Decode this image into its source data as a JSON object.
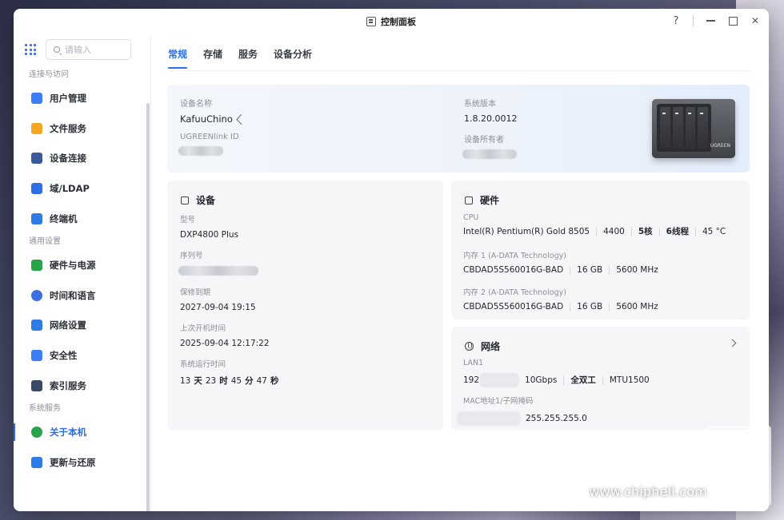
{
  "window": {
    "title": "控制面板"
  },
  "window_controls": {
    "help": "?"
  },
  "sidebar": {
    "search_placeholder": "请输入",
    "groups": [
      {
        "label": "连接与访问",
        "items": [
          {
            "label": "用户管理",
            "icon": "user-icon",
            "color": "#3d7df5"
          },
          {
            "label": "文件服务",
            "icon": "folder-icon",
            "color": "#f5a623"
          },
          {
            "label": "设备连接",
            "icon": "device-link-icon",
            "color": "#3a5a9c"
          },
          {
            "label": "域/LDAP",
            "icon": "domain-icon",
            "color": "#2f6fe4"
          },
          {
            "label": "终端机",
            "icon": "terminal-icon",
            "color": "#2f7be6"
          }
        ]
      },
      {
        "label": "通用设置",
        "items": [
          {
            "label": "硬件与电源",
            "icon": "battery-icon",
            "color": "#2aa44a"
          },
          {
            "label": "时间和语言",
            "icon": "globe-time-icon",
            "color": "#3a6fe0"
          },
          {
            "label": "网络设置",
            "icon": "network-icon",
            "color": "#2f7be6"
          },
          {
            "label": "安全性",
            "icon": "shield-icon",
            "color": "#3d7df5"
          },
          {
            "label": "索引服务",
            "icon": "index-icon",
            "color": "#3a4a66"
          }
        ]
      },
      {
        "label": "系统服务",
        "items": [
          {
            "label": "关于本机",
            "icon": "info-icon",
            "color": "#2aa44a",
            "active": true
          },
          {
            "label": "更新与还原",
            "icon": "refresh-icon",
            "color": "#2f7be6"
          }
        ]
      }
    ]
  },
  "tabs": [
    "常规",
    "存储",
    "服务",
    "设备分析"
  ],
  "summary": {
    "device_name_label": "设备名称",
    "device_name": "KafuuChino",
    "ugreen_id_label": "UGREENlink ID",
    "version_label": "系统版本",
    "version": "1.8.20.0012",
    "owner_label": "设备所有者"
  },
  "device_card": {
    "title": "设备",
    "model_label": "型号",
    "model": "DXP4800 Plus",
    "serial_label": "序列号",
    "warranty_label": "保修到期",
    "warranty": "2027-09-04 19:15",
    "last_boot_label": "上次开机时间",
    "last_boot": "2025-09-04 12:17:22",
    "uptime_label": "系统运行时间",
    "uptime": [
      "13",
      "天",
      "23",
      "时",
      "45",
      "分",
      "47",
      "秒"
    ]
  },
  "hardware_card": {
    "title": "硬件",
    "cpu_label": "CPU",
    "cpu": [
      "Intel(R) Pentium(R) Gold 8505",
      "4400",
      "5核",
      "6线程",
      "45 °C"
    ],
    "mem1_label": "内存 1 (A-DATA Technology)",
    "mem1": [
      "CBDAD5S560016G-BAD",
      "16 GB",
      "5600 MHz"
    ],
    "mem2_label": "内存 2 (A-DATA Technology)",
    "mem2": [
      "CBDAD5S560016G-BAD",
      "16 GB",
      "5600 MHz"
    ]
  },
  "network_card": {
    "title": "网络",
    "lan_label": "LAN1",
    "lan_ip_prefix": "192",
    "lan": [
      "10Gbps",
      "全双工",
      "MTU1500"
    ],
    "mac_label": "MAC地址1/子网掩码",
    "mask": "255.255.255.0"
  },
  "watermark": {
    "text": "www.chiphell.com"
  }
}
